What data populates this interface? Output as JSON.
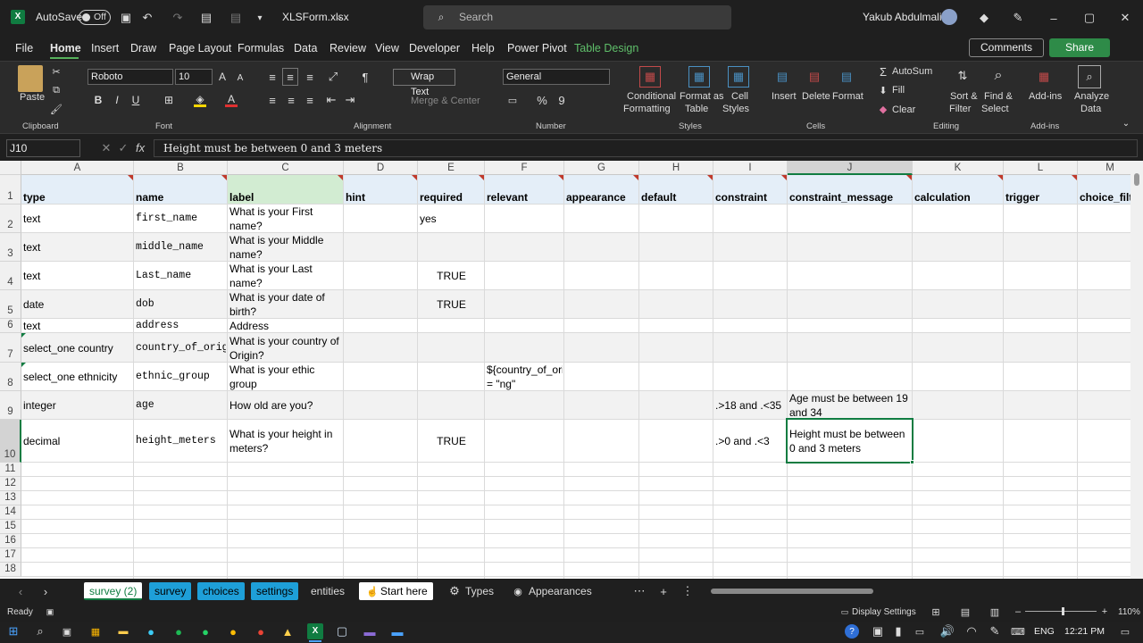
{
  "titlebar": {
    "autosave_label": "AutoSave",
    "autosave_state": "Off",
    "filename": "XLSForm.xlsx",
    "search_placeholder": "Search",
    "user_name": "Yakub Abdulmalik"
  },
  "menu": {
    "items": [
      "File",
      "Home",
      "Insert",
      "Draw",
      "Page Layout",
      "Formulas",
      "Data",
      "Review",
      "View",
      "Developer",
      "Help",
      "Power Pivot",
      "Table Design"
    ],
    "comments": "Comments",
    "share": "Share"
  },
  "ribbon": {
    "paste": "Paste",
    "font_name": "Roboto",
    "font_size": "10",
    "wrap_text": "Wrap Text",
    "merge_center": "Merge & Center",
    "number_format": "General",
    "conditional": [
      "Conditional",
      "Formatting"
    ],
    "format_table": [
      "Format as",
      "Table"
    ],
    "cell_styles": [
      "Cell",
      "Styles"
    ],
    "insert": "Insert",
    "delete": "Delete",
    "format": "Format",
    "autosum": "AutoSum",
    "fill": "Fill",
    "clear": "Clear",
    "sort_filter": [
      "Sort &",
      "Filter"
    ],
    "find_select": [
      "Find &",
      "Select"
    ],
    "addins": "Add-ins",
    "analyze": [
      "Analyze",
      "Data"
    ],
    "groups": {
      "clipboard": "Clipboard",
      "font": "Font",
      "alignment": "Alignment",
      "number": "Number",
      "styles": "Styles",
      "cells": "Cells",
      "editing": "Editing",
      "addins": "Add-ins"
    }
  },
  "formula_bar": {
    "name_box": "J10",
    "fx": "fx",
    "formula": "Height must be between 0 and 3 meters"
  },
  "columns": [
    "A",
    "B",
    "C",
    "D",
    "E",
    "F",
    "G",
    "H",
    "I",
    "J",
    "K",
    "L",
    "M"
  ],
  "headers": [
    "type",
    "name",
    "label",
    "hint",
    "required",
    "relevant",
    "appearance",
    "default",
    "constraint",
    "constraint_message",
    "calculation",
    "trigger",
    "choice_filt"
  ],
  "rows": [
    {
      "n": "2",
      "A": "text",
      "B": "first_name",
      "C": "What is your First name?",
      "E": "yes",
      "F": "",
      "I": "",
      "J": ""
    },
    {
      "n": "3",
      "A": "text",
      "B": "middle_name",
      "C": "What is your Middle name?",
      "E": "",
      "F": "",
      "I": "",
      "J": ""
    },
    {
      "n": "4",
      "A": "text",
      "B": "Last_name",
      "C": "What is your Last name?",
      "E": "TRUE",
      "F": "",
      "I": "",
      "J": ""
    },
    {
      "n": "5",
      "A": "date",
      "B": "dob",
      "C": "What is your date of birth?",
      "E": "TRUE",
      "F": "",
      "I": "",
      "J": ""
    },
    {
      "n": "6",
      "A": "text",
      "B": "address",
      "C": "Address",
      "E": "",
      "F": "",
      "I": "",
      "J": ""
    },
    {
      "n": "7",
      "A": "select_one country",
      "B": "country_of_origin",
      "C": "What is your country of Origin?",
      "E": "",
      "F": "",
      "I": "",
      "J": ""
    },
    {
      "n": "8",
      "A": "select_one ethnicity",
      "B": "ethnic_group",
      "C": "What is your ethic group",
      "E": "",
      "F": "${country_of_origin} = \"ng\"",
      "I": "",
      "J": ""
    },
    {
      "n": "9",
      "A": "integer",
      "B": "age",
      "C": "How old are you?",
      "E": "",
      "F": "",
      "I": ".>18 and .<35",
      "J": "Age must be between 19 and 34"
    },
    {
      "n": "10",
      "A": "decimal",
      "B": "height_meters",
      "C": "What is your height in meters?",
      "E": "TRUE",
      "F": "",
      "I": ".>0 and .<3",
      "J": "Height must be between 0 and 3 meters"
    }
  ],
  "empty_rows": [
    "11",
    "12",
    "13",
    "14",
    "15",
    "16",
    "17",
    "18"
  ],
  "sheet_tabs": [
    "survey (2)",
    "survey",
    "choices",
    "settings",
    "entities",
    "Start here",
    "Types",
    "Appearances"
  ],
  "status": {
    "ready": "Ready",
    "display_settings": "Display Settings",
    "zoom": "110%"
  },
  "taskbar": {
    "lang": "ENG",
    "time": "12:21 PM"
  }
}
